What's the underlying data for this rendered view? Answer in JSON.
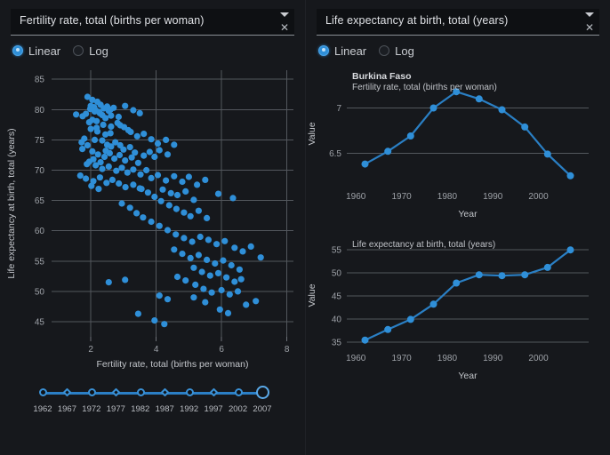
{
  "theme": {
    "background": "#111215",
    "panel_background": "#16181c",
    "accent": "#2f8fd8",
    "line": "#2a7fc4",
    "grid": "#53575d",
    "text": "#d8dadd"
  },
  "left_panel": {
    "selector": {
      "value": "Fertility rate, total (births per woman)",
      "caret_icon": "chevron-down-icon",
      "close_icon": "close-icon"
    },
    "scale": {
      "options": [
        {
          "label": "Linear",
          "selected": true
        },
        {
          "label": "Log",
          "selected": false
        }
      ]
    },
    "slider": {
      "years": [
        "1962",
        "1967",
        "1972",
        "1977",
        "1982",
        "1987",
        "1992",
        "1997",
        "2002",
        "2007"
      ],
      "selected": "2007"
    }
  },
  "right_panel": {
    "selector": {
      "value": "Life expectancy at birth, total (years)",
      "caret_icon": "chevron-down-icon",
      "close_icon": "close-icon"
    },
    "scale": {
      "options": [
        {
          "label": "Linear",
          "selected": true
        },
        {
          "label": "Log",
          "selected": false
        }
      ]
    }
  },
  "chart_data": [
    {
      "id": "scatter",
      "type": "scatter",
      "title": "",
      "xlabel": "Fertility rate, total (births per woman)",
      "ylabel": "Life expectancy at birth, total (years)",
      "xlim": [
        0.8,
        8.2
      ],
      "ylim": [
        42.5,
        86.5
      ],
      "xticks": [
        2,
        4,
        6,
        8
      ],
      "yticks": [
        45,
        50,
        55,
        60,
        65,
        70,
        75,
        80,
        85
      ],
      "grid": true,
      "legend": "none",
      "point_color": "#2f8fd8",
      "points": [
        [
          1.9,
          82.1
        ],
        [
          2.05,
          81.6
        ],
        [
          1.85,
          79.3
        ],
        [
          2.2,
          81.3
        ],
        [
          2.0,
          80.6
        ],
        [
          1.55,
          79.2
        ],
        [
          2.1,
          80.4
        ],
        [
          2.15,
          79.9
        ],
        [
          1.98,
          80.1
        ],
        [
          2.3,
          80.8
        ],
        [
          2.4,
          80.2
        ],
        [
          2.25,
          79.6
        ],
        [
          2.5,
          80.5
        ],
        [
          2.35,
          79.1
        ],
        [
          2.6,
          80.0
        ],
        [
          1.75,
          78.9
        ],
        [
          2.45,
          78.6
        ],
        [
          2.05,
          78.3
        ],
        [
          2.28,
          79.4
        ],
        [
          2.12,
          79.7
        ],
        [
          2.55,
          79.8
        ],
        [
          2.7,
          80.3
        ],
        [
          2.62,
          79.0
        ],
        [
          2.18,
          78.1
        ],
        [
          1.95,
          77.9
        ],
        [
          3.05,
          80.6
        ],
        [
          3.3,
          79.9
        ],
        [
          2.85,
          78.8
        ],
        [
          3.5,
          79.4
        ],
        [
          2.9,
          77.4
        ],
        [
          3.15,
          76.6
        ],
        [
          2.6,
          76.1
        ],
        [
          2.45,
          75.9
        ],
        [
          2.2,
          76.4
        ],
        [
          2.0,
          76.8
        ],
        [
          1.8,
          75.2
        ],
        [
          1.72,
          74.6
        ],
        [
          2.12,
          75.0
        ],
        [
          2.35,
          74.9
        ],
        [
          2.5,
          74.2
        ],
        [
          2.62,
          73.9
        ],
        [
          2.75,
          74.6
        ],
        [
          2.9,
          74.1
        ],
        [
          3.0,
          73.4
        ],
        [
          3.2,
          73.8
        ],
        [
          3.35,
          72.9
        ],
        [
          2.05,
          73.1
        ],
        [
          2.22,
          72.6
        ],
        [
          2.42,
          72.2
        ],
        [
          2.58,
          72.8
        ],
        [
          2.72,
          71.9
        ],
        [
          2.88,
          72.5
        ],
        [
          3.05,
          71.6
        ],
        [
          3.25,
          72.1
        ],
        [
          3.45,
          71.2
        ],
        [
          3.62,
          72.4
        ],
        [
          3.8,
          73.0
        ],
        [
          3.95,
          72.2
        ],
        [
          4.1,
          73.3
        ],
        [
          4.35,
          72.6
        ],
        [
          1.95,
          71.4
        ],
        [
          2.15,
          70.8
        ],
        [
          2.35,
          70.2
        ],
        [
          2.55,
          70.6
        ],
        [
          2.78,
          69.9
        ],
        [
          2.95,
          70.4
        ],
        [
          3.12,
          69.6
        ],
        [
          3.3,
          70.1
        ],
        [
          3.52,
          69.3
        ],
        [
          3.7,
          70.0
        ],
        [
          1.68,
          69.1
        ],
        [
          1.85,
          68.6
        ],
        [
          2.08,
          68.2
        ],
        [
          2.28,
          68.8
        ],
        [
          2.48,
          67.9
        ],
        [
          3.85,
          68.7
        ],
        [
          4.05,
          69.2
        ],
        [
          4.3,
          68.3
        ],
        [
          4.55,
          69.0
        ],
        [
          4.8,
          68.1
        ],
        [
          5.0,
          68.9
        ],
        [
          5.25,
          67.6
        ],
        [
          5.5,
          68.4
        ],
        [
          5.9,
          66.1
        ],
        [
          6.35,
          65.4
        ],
        [
          4.2,
          66.8
        ],
        [
          4.45,
          66.2
        ],
        [
          4.65,
          65.9
        ],
        [
          4.9,
          66.5
        ],
        [
          5.15,
          65.1
        ],
        [
          3.55,
          66.9
        ],
        [
          3.75,
          66.3
        ],
        [
          3.95,
          65.6
        ],
        [
          4.15,
          64.9
        ],
        [
          4.4,
          64.2
        ],
        [
          4.62,
          63.6
        ],
        [
          4.85,
          63.0
        ],
        [
          5.05,
          62.4
        ],
        [
          5.3,
          63.3
        ],
        [
          5.55,
          62.1
        ],
        [
          2.95,
          64.5
        ],
        [
          3.2,
          63.8
        ],
        [
          3.4,
          62.9
        ],
        [
          3.6,
          62.2
        ],
        [
          3.85,
          61.5
        ],
        [
          4.1,
          60.8
        ],
        [
          4.35,
          60.1
        ],
        [
          4.6,
          59.4
        ],
        [
          4.85,
          58.8
        ],
        [
          5.1,
          58.2
        ],
        [
          5.35,
          59.0
        ],
        [
          5.6,
          58.5
        ],
        [
          5.85,
          57.8
        ],
        [
          6.1,
          58.3
        ],
        [
          6.4,
          57.2
        ],
        [
          6.65,
          56.6
        ],
        [
          6.9,
          57.4
        ],
        [
          7.2,
          55.6
        ],
        [
          4.55,
          56.9
        ],
        [
          4.8,
          56.2
        ],
        [
          5.05,
          55.5
        ],
        [
          5.3,
          56.0
        ],
        [
          5.55,
          55.2
        ],
        [
          5.8,
          54.6
        ],
        [
          6.05,
          55.1
        ],
        [
          6.3,
          54.3
        ],
        [
          6.55,
          53.6
        ],
        [
          5.15,
          53.9
        ],
        [
          5.4,
          53.2
        ],
        [
          5.65,
          52.6
        ],
        [
          5.9,
          53.0
        ],
        [
          6.15,
          52.3
        ],
        [
          6.4,
          51.6
        ],
        [
          6.6,
          52.0
        ],
        [
          4.65,
          52.4
        ],
        [
          4.9,
          51.8
        ],
        [
          5.2,
          51.1
        ],
        [
          5.45,
          50.4
        ],
        [
          5.7,
          49.8
        ],
        [
          6.0,
          50.2
        ],
        [
          6.25,
          49.5
        ],
        [
          6.5,
          50.0
        ],
        [
          3.05,
          51.9
        ],
        [
          2.55,
          51.5
        ],
        [
          4.1,
          49.3
        ],
        [
          4.35,
          48.7
        ],
        [
          5.15,
          49.0
        ],
        [
          5.5,
          48.2
        ],
        [
          3.95,
          45.2
        ],
        [
          4.25,
          44.6
        ],
        [
          3.45,
          46.3
        ],
        [
          5.95,
          47.0
        ],
        [
          6.2,
          46.4
        ],
        [
          6.75,
          47.8
        ],
        [
          7.05,
          48.4
        ],
        [
          2.62,
          77.2
        ],
        [
          2.82,
          77.8
        ],
        [
          3.02,
          77.1
        ],
        [
          3.22,
          76.3
        ],
        [
          3.42,
          75.6
        ],
        [
          3.62,
          76.0
        ],
        [
          3.85,
          75.1
        ],
        [
          4.05,
          74.4
        ],
        [
          4.3,
          75.0
        ],
        [
          4.55,
          74.2
        ],
        [
          2.38,
          77.5
        ],
        [
          2.18,
          77.0
        ],
        [
          1.9,
          74.1
        ],
        [
          1.74,
          73.5
        ],
        [
          2.46,
          73.2
        ],
        [
          2.66,
          68.4
        ],
        [
          2.86,
          67.8
        ],
        [
          3.06,
          67.2
        ],
        [
          3.3,
          67.6
        ],
        [
          3.5,
          67.0
        ],
        [
          2.02,
          67.4
        ],
        [
          2.24,
          66.9
        ],
        [
          1.88,
          71.0
        ],
        [
          2.08,
          71.8
        ],
        [
          2.3,
          71.3
        ]
      ]
    },
    {
      "id": "fertility-line",
      "type": "line",
      "title": "Burkina Faso",
      "subtitle": "Fertility rate, total (births per woman)",
      "xlabel": "Year",
      "ylabel": "Value",
      "xlim": [
        1958,
        2011
      ],
      "ylim": [
        6.15,
        7.28
      ],
      "xticks": [
        1960,
        1970,
        1980,
        1990,
        2000
      ],
      "yticks": [
        6.5,
        7
      ],
      "grid": true,
      "x": [
        1962,
        1967,
        1972,
        1977,
        1982,
        1987,
        1992,
        1997,
        2002,
        2007
      ],
      "values": [
        6.38,
        6.52,
        6.69,
        7.0,
        7.18,
        7.1,
        6.98,
        6.79,
        6.49,
        6.25
      ]
    },
    {
      "id": "life-expectancy-line",
      "type": "line",
      "title": "",
      "subtitle": "Life expectancy at birth, total (years)",
      "xlabel": "Year",
      "ylabel": "Value",
      "xlim": [
        1958,
        2011
      ],
      "ylim": [
        34.0,
        56.2
      ],
      "xticks": [
        1960,
        1970,
        1980,
        1990,
        2000
      ],
      "yticks": [
        35,
        40,
        45,
        50,
        55
      ],
      "grid": true,
      "x": [
        1962,
        1967,
        1972,
        1977,
        1982,
        1987,
        1992,
        1997,
        2002,
        2007
      ],
      "values": [
        35.4,
        37.7,
        39.9,
        43.2,
        47.8,
        49.6,
        49.4,
        49.6,
        51.2,
        55.0
      ]
    }
  ]
}
